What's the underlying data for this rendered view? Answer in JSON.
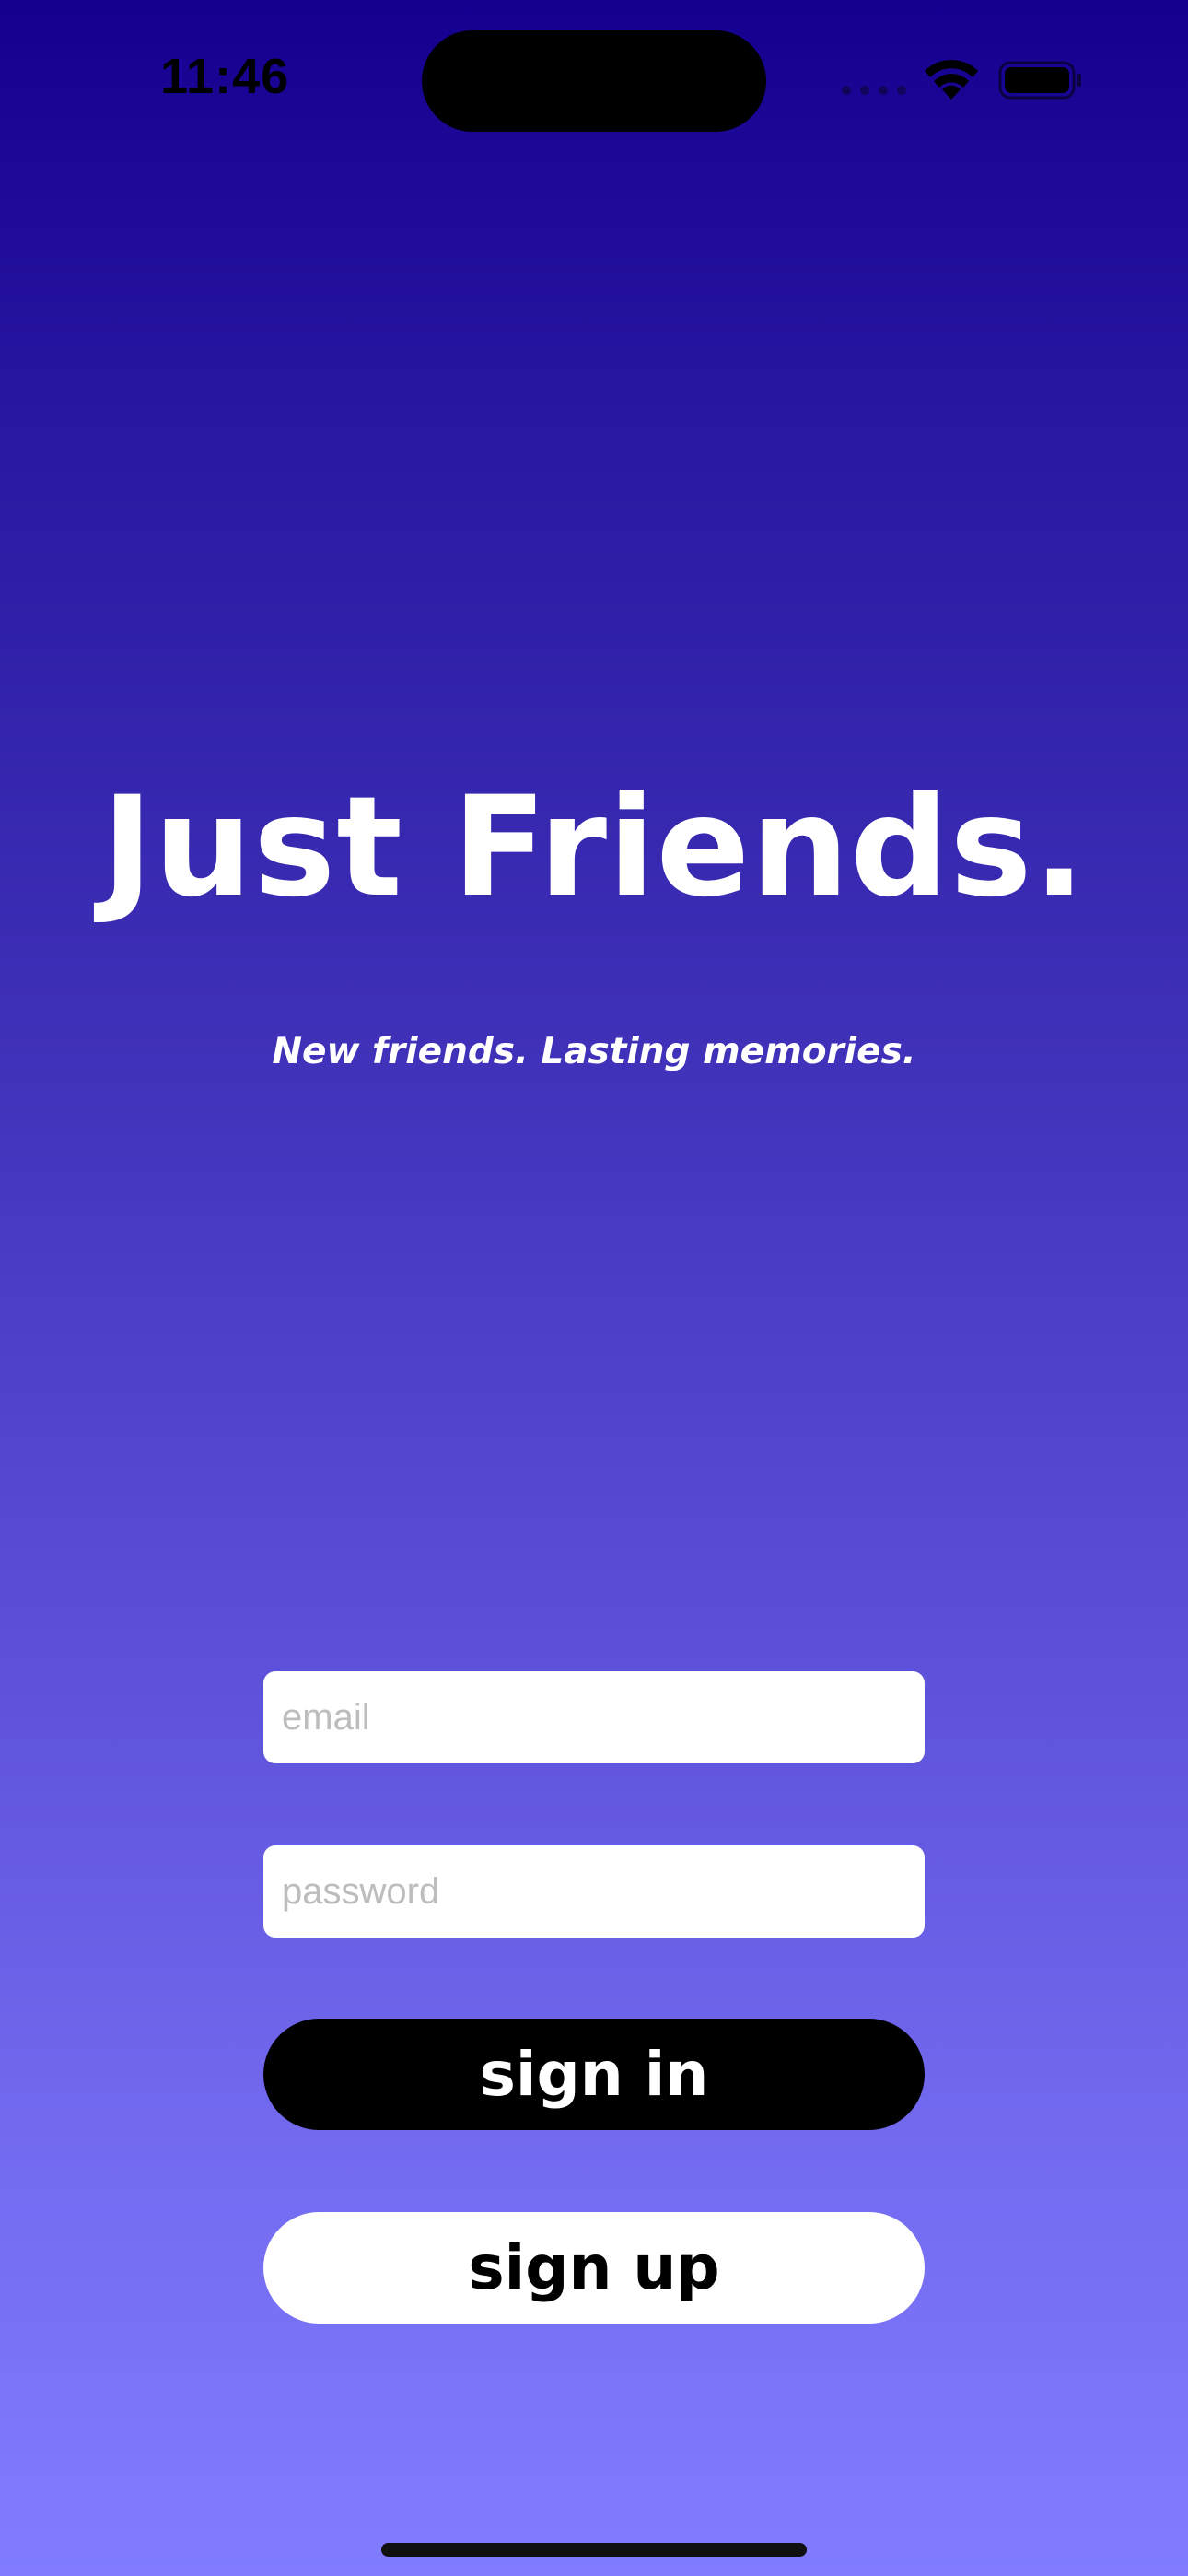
{
  "status_bar": {
    "time": "11:46",
    "icons": [
      "cellular-signal-icon",
      "wifi-icon",
      "battery-icon"
    ]
  },
  "app": {
    "title": "Just Friends.",
    "tagline": "New friends. Lasting memories."
  },
  "form": {
    "email": {
      "value": "",
      "placeholder": "email"
    },
    "password": {
      "value": "",
      "placeholder": "password"
    },
    "sign_in_label": "sign in",
    "sign_up_label": "sign up"
  },
  "colors": {
    "gradient_top": "#14008f",
    "gradient_bottom": "#817cff",
    "primary_button": "#000000",
    "secondary_button": "#ffffff",
    "text_on_background": "#ffffff"
  }
}
